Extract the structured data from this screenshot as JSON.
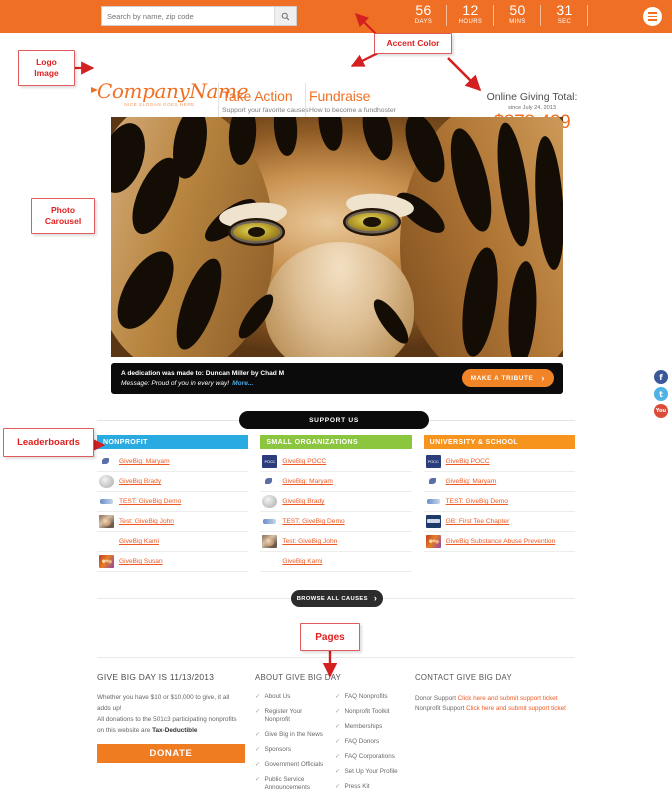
{
  "topbar": {
    "search": {
      "placeholder": "Search by name, zip code",
      "value": ""
    },
    "search_icon": "search-icon",
    "menu_icon": "hamburger-menu-icon",
    "countdown": [
      {
        "num": "56",
        "label": "DAYS"
      },
      {
        "num": "12",
        "label": "HOURS"
      },
      {
        "num": "50",
        "label": "MINS"
      },
      {
        "num": "31",
        "label": "SEC"
      }
    ]
  },
  "header": {
    "logo_name": "CompanyName",
    "logo_slogan": "NICE SLOGAN GOES HERE",
    "nav": [
      {
        "title": "Take Action",
        "sub": "Support your favorite causes"
      },
      {
        "title": "Fundraise",
        "sub": "How to become a fundhoster"
      }
    ],
    "giving": {
      "title": "Online Giving Total:",
      "since": "since July 24, 2013",
      "amount": "$878,429"
    }
  },
  "carousel": {
    "image_alt": "tiger-photo"
  },
  "dedication": {
    "line1": "A dedication was made to: Duncan Miller by Chad M",
    "line2": "Message: Proud of you in every way!",
    "more": "More...",
    "button": "MAKE A TRIBUTE"
  },
  "support_us": {
    "label": "SUPPORT US"
  },
  "boards": [
    {
      "heading": "NONPROFIT",
      "color": "#29abe2",
      "rows": [
        {
          "avatar": "av-bird",
          "label": "GiveBig: Maryam"
        },
        {
          "avatar": "av-ball",
          "label": "GiveBig Brady"
        },
        {
          "avatar": "av-logo",
          "label": "TEST: GiveBig Demo"
        },
        {
          "avatar": "av-photo",
          "label": "Test: GiveBig John"
        },
        {
          "avatar": "blank",
          "label": "GiveBig Kami"
        },
        {
          "avatar": "av-group",
          "label": "GiveBig Susan"
        }
      ]
    },
    {
      "heading": "SMALL ORGANIZATIONS",
      "color": "#8cc63e",
      "rows": [
        {
          "avatar": "av-pocc",
          "label": "GiveBig POCC"
        },
        {
          "avatar": "av-bird",
          "label": "GiveBig: Maryam"
        },
        {
          "avatar": "av-ball",
          "label": "GiveBig Brady"
        },
        {
          "avatar": "av-logo",
          "label": "TEST: GiveBig Demo"
        },
        {
          "avatar": "av-photo",
          "label": "Test: GiveBig John"
        },
        {
          "avatar": "blank",
          "label": "GiveBig Kami"
        }
      ]
    },
    {
      "heading": "UNIVERSITY & SCHOOL",
      "color": "#f7941e",
      "rows": [
        {
          "avatar": "av-pocc",
          "label": "GiveBig POCC"
        },
        {
          "avatar": "av-bird",
          "label": "GiveBig: Maryam"
        },
        {
          "avatar": "av-logo",
          "label": "TEST: GiveBig Demo"
        },
        {
          "avatar": "av-dark",
          "label": "GB: First Tee Chapter"
        },
        {
          "avatar": "av-group",
          "label": "GiveBig Substance Abuse Prevention"
        }
      ]
    }
  ],
  "browse": {
    "label": "BROWSE ALL CAUSES"
  },
  "footer": {
    "col1": {
      "title": "GIVE BIG DAY IS  11/13/2013",
      "body_line1": "Whether you have $10 or $10,000 to give, it all adds up!",
      "body_line2": "All donations to the 501c3 participating nonprofits on this website are",
      "body_bold": "Tax-Deductible",
      "donate": "DONATE"
    },
    "col2": {
      "title": "ABOUT GIVE BIG DAY",
      "links_left": [
        "About Us",
        "Register Your Nonprofit",
        "Give Big in the News",
        "Sponsors",
        "Government Officials",
        "Public Service Announcements"
      ],
      "links_right": [
        "FAQ Nonprofits",
        "Nonprofit Toolkit",
        "Memberships",
        "FAQ Donors",
        "FAQ Corporations",
        "Set Up Your Profile",
        "Press Kit"
      ]
    },
    "col3": {
      "title": "CONTACT GIVE BIG DAY",
      "donor_label": "Donor Support",
      "donor_link": "Click here and submit support ticket",
      "nonprofit_label": "Nonprofit Support",
      "nonprofit_link": "Click here and submit support ticket"
    }
  },
  "social": [
    {
      "name": "facebook-icon",
      "glyph": "f"
    },
    {
      "name": "twitter-icon",
      "glyph": "t"
    },
    {
      "name": "youtube-icon",
      "glyph": "You"
    }
  ],
  "annotations": {
    "logo_image": "Logo\nImage",
    "logo_image_l1": "Logo",
    "logo_image_l2": "Image",
    "accent_color": "Accent Color",
    "photo_carousel_l1": "Photo",
    "photo_carousel_l2": "Carousel",
    "leaderboards": "Leaderboards",
    "pages": "Pages"
  },
  "colors": {
    "accent": "#ef7024",
    "nonprofit": "#29abe2",
    "small_orgs": "#8cc63e",
    "university": "#f7941e",
    "annotation": "#e02020"
  }
}
